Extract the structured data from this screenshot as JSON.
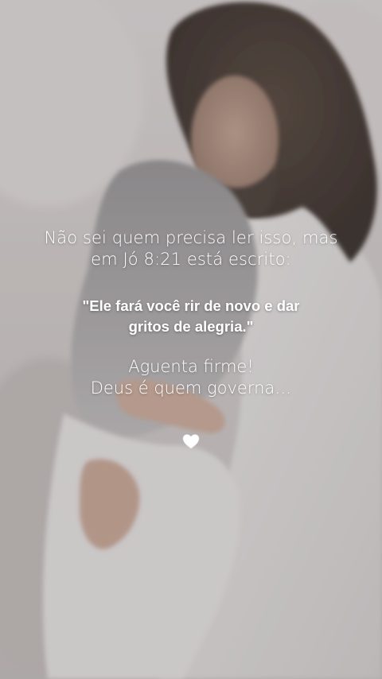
{
  "message": {
    "intro_line_1": "Não sei quem precisa ler isso, mas",
    "intro_line_2": "em Jó 8:21 está escrito:",
    "quote_line_1": "\"Ele fará você rir de novo e dar",
    "quote_line_2": "gritos de alegria.\"",
    "closing_line_1": "Aguenta firme!",
    "closing_line_2": "Deus é quem governa…"
  },
  "decoration": {
    "heart_icon": "white-heart-icon",
    "heart_color": "#ffffff"
  },
  "colors": {
    "text": "#ffffff",
    "background": "#cfc9c6"
  }
}
